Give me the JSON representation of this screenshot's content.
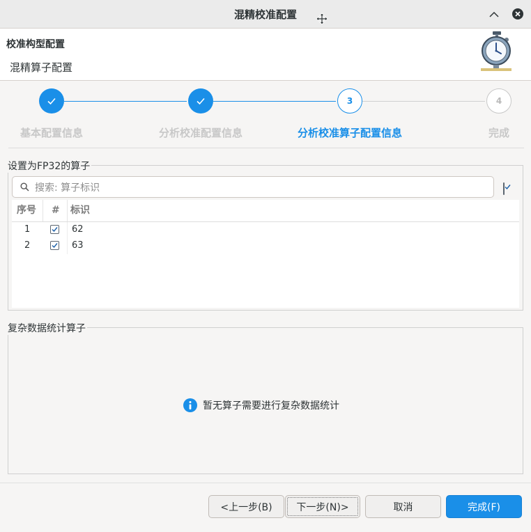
{
  "window": {
    "title": "混精校准配置"
  },
  "header": {
    "title": "校准构型配置",
    "subtitle": "混精算子配置"
  },
  "stepper": {
    "steps": [
      {
        "number": "1",
        "label": "基本配置信息",
        "state": "done"
      },
      {
        "number": "2",
        "label": "分析校准配置信息",
        "state": "done"
      },
      {
        "number": "3",
        "label": "分析校准算子配置信息",
        "state": "active"
      },
      {
        "number": "4",
        "label": "完成",
        "state": "pending"
      }
    ]
  },
  "fp32_group": {
    "legend": "设置为FP32的算子",
    "search_placeholder": "搜索: 算子标识",
    "select_all_checked": true,
    "columns": [
      "序号",
      "#",
      "标识"
    ],
    "rows": [
      {
        "index": "1",
        "checked": true,
        "id": "62"
      },
      {
        "index": "2",
        "checked": true,
        "id": "63"
      }
    ]
  },
  "complex_group": {
    "legend": "复杂数据统计算子",
    "empty_message": "暂无算子需要进行复杂数据统计"
  },
  "buttons": {
    "prev": "<上一步(B)",
    "next": "下一步(N)>",
    "cancel": "取消",
    "finish": "完成(F)"
  },
  "colors": {
    "accent": "#1a8fe8",
    "pending": "#c8c8c8"
  }
}
